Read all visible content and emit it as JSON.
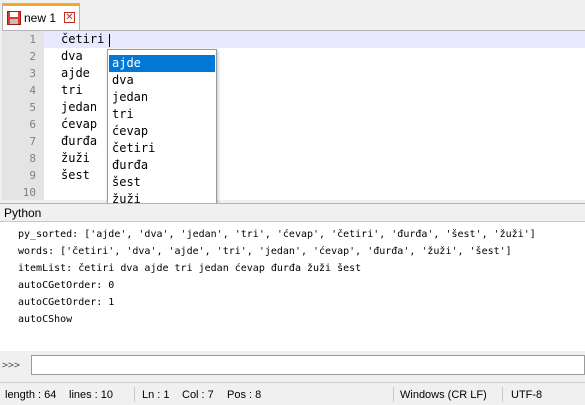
{
  "tab": {
    "label": "new 1",
    "close_symbol": "✕"
  },
  "editor": {
    "line_numbers": [
      "1",
      "2",
      "3",
      "4",
      "5",
      "6",
      "7",
      "8",
      "9",
      "10"
    ],
    "lines": [
      "četiri",
      "dva",
      "ajde",
      "tri",
      "jedan",
      "ćevap",
      "đurđa",
      "žuži",
      "šest",
      ""
    ]
  },
  "autocomplete": {
    "items": [
      "ajde",
      "dva",
      "jedan",
      "tri",
      "ćevap",
      "četiri",
      "đurđa",
      "šest",
      "žuži"
    ],
    "selected": "ajde"
  },
  "python_panel": {
    "title": "Python",
    "output": [
      "py_sorted: ['ajde', 'dva', 'jedan', 'tri', 'ćevap', 'četiri', 'đurđa', 'šest', 'žuži']",
      "words: ['četiri', 'dva', 'ajde', 'tri', 'jedan', 'ćevap', 'đurđa', 'žuži', 'šest']",
      "itemList: četiri dva ajde tri jedan ćevap đurđa žuži šest",
      "autoCGetOrder: 0",
      "autoCGetOrder: 1",
      "autoCShow"
    ],
    "prompt": ">>>",
    "input_value": ""
  },
  "status": {
    "length": "length : 64",
    "lines": "lines : 10",
    "ln": "Ln : 1",
    "col": "Col : 7",
    "pos": "Pos : 8",
    "eol": "Windows (CR LF)",
    "encoding": "UTF-8"
  },
  "colors": {
    "selection": "#0078d7",
    "gutter": "#e4e4e4",
    "current_line": "#e8e8ff",
    "tab_accent": "#f5a623"
  }
}
